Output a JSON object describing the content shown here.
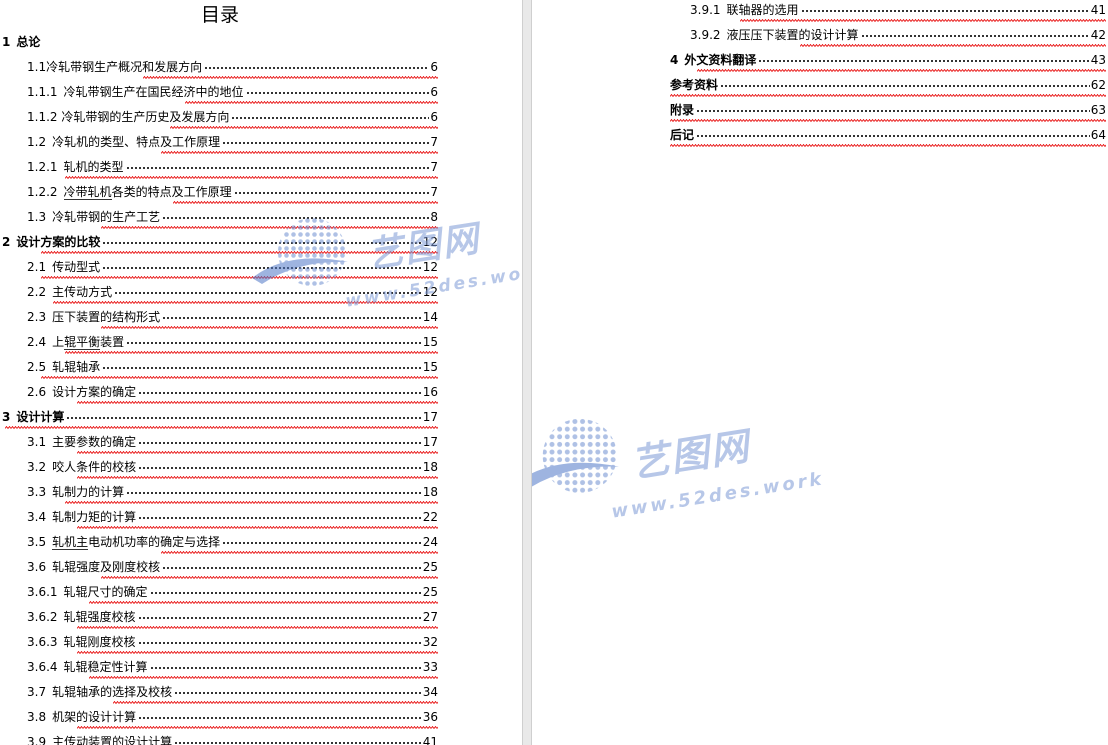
{
  "toc_title": "目录",
  "left_entries": [
    {
      "level": 1,
      "num": "1",
      "text": "总论",
      "page": ""
    },
    {
      "level": 2,
      "num": "",
      "text": "1.1冷轧带钢生产概况和发展方向",
      "page": "6"
    },
    {
      "level": 3,
      "num": "1.1.1",
      "text": "冷轧带钢生产在国民经济中的地位",
      "page": "6"
    },
    {
      "level": 3,
      "num": "",
      "text": "1.1.2 冷轧带钢的生产历史及发展方向",
      "page": "6"
    },
    {
      "level": 2,
      "num": "1.2",
      "text": "冷轧机的类型、特点及工作原理",
      "page": "7"
    },
    {
      "level": 3,
      "num": "1.2.1",
      "text": "轧机的类型",
      "page": "7"
    },
    {
      "level": 3,
      "num": "1.2.2",
      "text_u": "冷带轧机",
      "text": "各类的特点及工作原理",
      "page": "7"
    },
    {
      "level": 2,
      "num": "1.3",
      "text": "冷轧带钢的生产工艺",
      "page": "8"
    },
    {
      "level": 1,
      "num": "2",
      "text": "设计方案的比较",
      "page": "12"
    },
    {
      "level": 2,
      "num": "2.1",
      "text": "传动型式",
      "page": "12"
    },
    {
      "level": 2,
      "num": "2.2",
      "text": "主传动方式",
      "page": "12"
    },
    {
      "level": 2,
      "num": "2.3",
      "text": "压下装置的结构形式",
      "page": "14"
    },
    {
      "level": 2,
      "num": "2.4",
      "text_pre": "上",
      "text_u": "辊平衡",
      "text": "装置",
      "page": "15"
    },
    {
      "level": 2,
      "num": "2.5",
      "text": "轧辊轴承",
      "page": "15"
    },
    {
      "level": 2,
      "num": "2.6",
      "text": "设计方案的确定",
      "page": "16"
    },
    {
      "level": 1,
      "num": "3",
      "text": "设计计算",
      "page": "17"
    },
    {
      "level": 2,
      "num": "3.1",
      "text": "主要参数的确定",
      "page": "17"
    },
    {
      "level": 2,
      "num": "3.2",
      "text": "咬人条件的校核",
      "page": "18"
    },
    {
      "level": 2,
      "num": "3.3",
      "text": "轧制力的计算",
      "page": "18"
    },
    {
      "level": 2,
      "num": "3.4",
      "text": "轧制力矩的计算",
      "page": "22"
    },
    {
      "level": 2,
      "num": "3.5",
      "text_u": "轧机主",
      "text": "电动机功率的确定与选择",
      "page": "24"
    },
    {
      "level": 2,
      "num": "3.6",
      "text": "轧辊强度及刚度校核",
      "page": "25"
    },
    {
      "level": 3,
      "num": "3.6.1",
      "text": "轧辊尺寸的确定",
      "page": "25"
    },
    {
      "level": 3,
      "num": "3.6.2",
      "text": "轧辊强度校核",
      "page": "27"
    },
    {
      "level": 3,
      "num": "3.6.3",
      "text": "轧辊刚度校核",
      "page": "32"
    },
    {
      "level": 3,
      "num": "3.6.4",
      "text": "轧辊稳定性计算",
      "page": "33"
    },
    {
      "level": 2,
      "num": "3.7",
      "text": "轧辊轴承的选择及校核",
      "page": "34"
    },
    {
      "level": 2,
      "num": "3.8",
      "text": "机架的设计计算",
      "page": "36"
    },
    {
      "level": 2,
      "num": "3.9",
      "text": "主传动装置的设计计算",
      "page": "41"
    }
  ],
  "right_entries": [
    {
      "level": 3,
      "num": "3.9.1",
      "text": "联轴器的选用",
      "page": "41"
    },
    {
      "level": 3,
      "num": "3.9.2",
      "text": "液压压下装置的设计计算",
      "page": "42"
    },
    {
      "level": 1,
      "num": "4",
      "text": "外文资料翻译",
      "page": "43"
    },
    {
      "level": 1,
      "num": "",
      "text": "参考资料",
      "page": "62"
    },
    {
      "level": 1,
      "num": "",
      "text": "附录",
      "page": "63"
    },
    {
      "level": 1,
      "num": "",
      "text": "后记",
      "page": "64"
    }
  ],
  "watermark": {
    "brand_cn": "艺图网",
    "url": "www.52des.work"
  },
  "colors": {
    "spellcheck_underline": "#e60000",
    "watermark": "#7e9ad6",
    "gutter": "#e9e9e9"
  }
}
